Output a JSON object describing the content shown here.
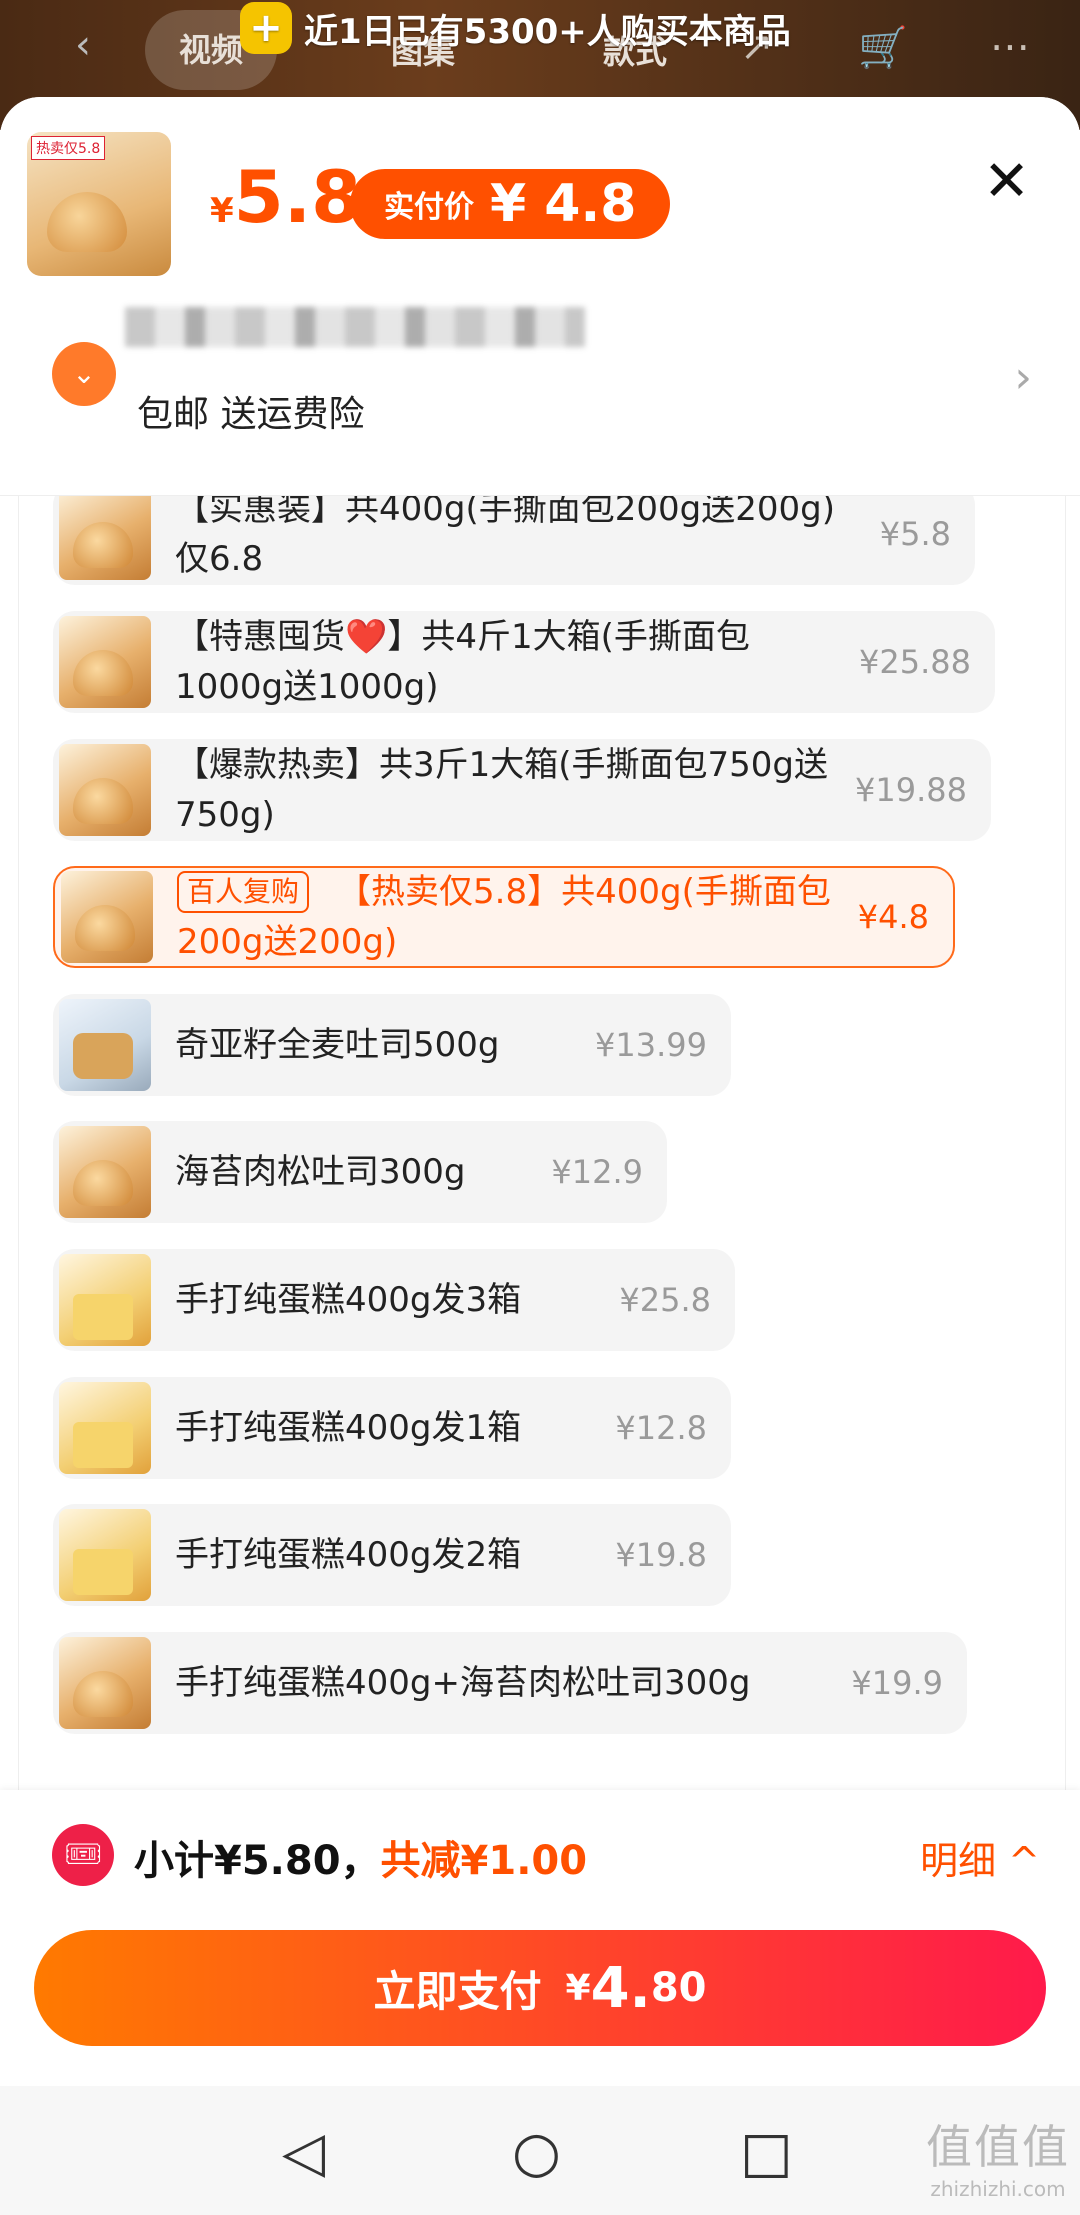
{
  "top": {
    "tabs": [
      "视频",
      "图集",
      "款式"
    ],
    "banner": "近1日已有5300+人购买本商品"
  },
  "header": {
    "thumb_tag": "热卖仅5.8",
    "currency": "¥",
    "price": "5.8",
    "pay_label": "实付价",
    "pay_price": "¥ 4.8",
    "shipping": "包邮  送运费险"
  },
  "items": [
    {
      "name": "【实惠装】共400g(手撕面包200g送200g) 仅6.8",
      "price": "¥5.8"
    },
    {
      "name": "【特惠囤货❤️】共4斤1大箱(手撕面包1000g送1000g)",
      "price": "¥25.88"
    },
    {
      "name": "【爆款热卖】共3斤1大箱(手撕面包750g送750g)",
      "price": "¥19.88"
    },
    {
      "tag": "百人复购",
      "name": "【热卖仅5.8】共400g(手撕面包200g送200g)",
      "price": "¥4.8"
    },
    {
      "name": "奇亚籽全麦吐司500g",
      "price": "¥13.99"
    },
    {
      "name": "海苔肉松吐司300g",
      "price": "¥12.9"
    },
    {
      "name": "手打纯蛋糕400g发3箱",
      "price": "¥25.8"
    },
    {
      "name": "手打纯蛋糕400g发1箱",
      "price": "¥12.8"
    },
    {
      "name": "手打纯蛋糕400g发2箱",
      "price": "¥19.8"
    },
    {
      "name": "手打纯蛋糕400g+海苔肉松吐司300g",
      "price": "¥19.9"
    }
  ],
  "footer": {
    "subtotal": "小计¥5.80，",
    "reduce": "共减¥1.00",
    "detail": "明细 ^",
    "pay_label": "立即支付",
    "pay_yen": "¥",
    "pay_int": "4.",
    "pay_dec": "80"
  },
  "watermark": {
    "big": "值值值",
    "small": "zhizhizhi.com"
  },
  "colors": {
    "accent": "#ff5000",
    "pay_gradient_start": "#ff7a00",
    "pay_gradient_end": "#ff1a4b"
  }
}
